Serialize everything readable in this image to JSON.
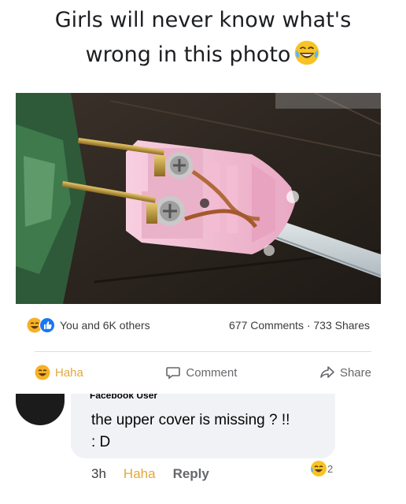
{
  "caption": {
    "line1": "Girls will never know what's",
    "line2": "wrong in this photo",
    "emoji": "laugh-crying-emoji"
  },
  "photo": {
    "subject": "plug-with-exposed-screws-photo"
  },
  "reactions": {
    "count_text": "You and 6K others",
    "stats_text": "677 Comments · 733 Shares",
    "icons": [
      "haha-icon",
      "like-icon"
    ]
  },
  "actions": {
    "haha_label": "Haha",
    "comment_label": "Comment",
    "share_label": "Share"
  },
  "comment": {
    "author": "Facebook User",
    "text_line1": "the upper cover is missing ? !!",
    "text_line2": ": D",
    "time": "3h",
    "haha_label": "Haha",
    "reply_label": "Reply",
    "reaction_count": "2"
  },
  "colors": {
    "haha": "#f7b125",
    "like": "#1877f2",
    "bubble": "#f0f2f5"
  }
}
